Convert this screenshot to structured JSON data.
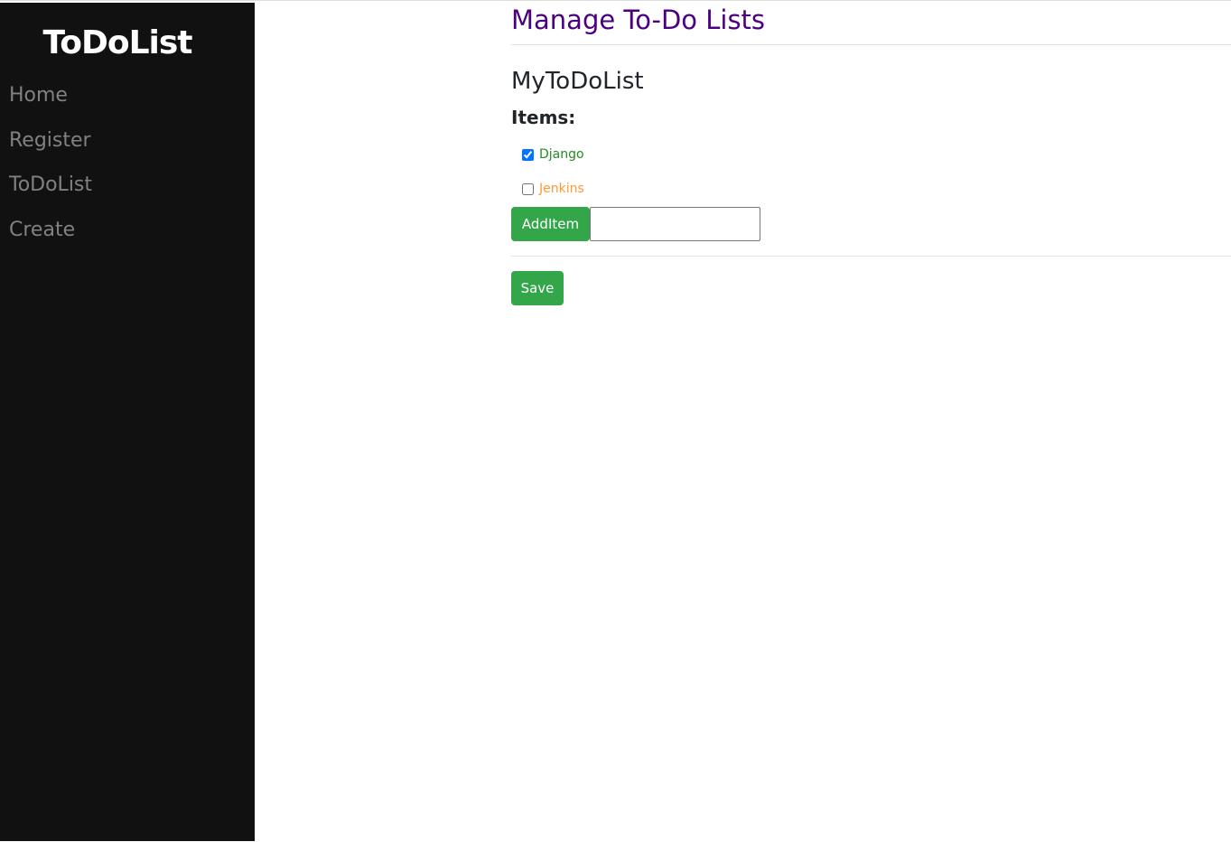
{
  "sidebar": {
    "brand": "ToDoList",
    "items": [
      {
        "label": "Home"
      },
      {
        "label": "Register"
      },
      {
        "label": "ToDoList"
      },
      {
        "label": "Create"
      }
    ]
  },
  "main": {
    "title": "Manage To-Do Lists",
    "list_name": "MyToDoList",
    "items_heading": "Items:",
    "items": [
      {
        "label": "Django",
        "checked": true,
        "color": "#228b22"
      },
      {
        "label": "Jenkins",
        "checked": false,
        "color": "#ff9933"
      }
    ],
    "add_item_label": "AddItem",
    "new_item_value": "",
    "save_label": "Save"
  }
}
